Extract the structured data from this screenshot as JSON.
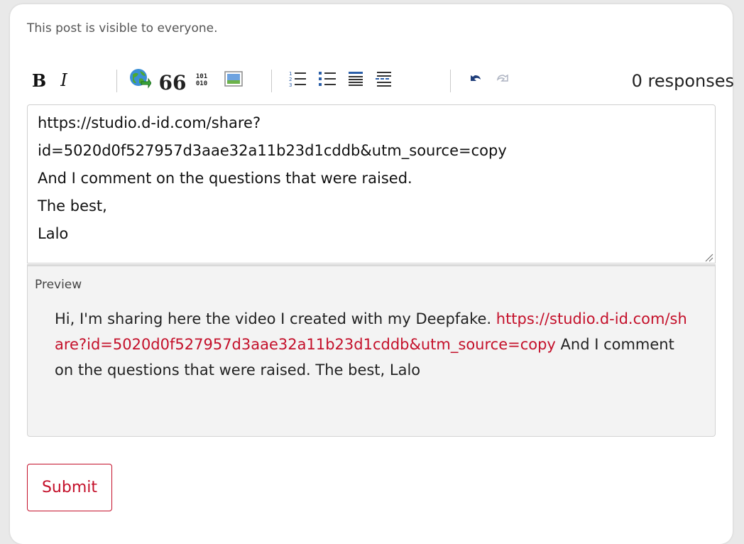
{
  "notice": "This post is visible to everyone.",
  "toolbar": {
    "bold_label": "B",
    "italic_label": "I",
    "quote_label": "66",
    "code_top": "101",
    "code_bottom": "010",
    "responses": "0 responses",
    "icons": [
      "bold-icon",
      "italic-icon",
      "link-icon",
      "blockquote-icon",
      "code-sample-icon",
      "image-icon",
      "numbered-list-icon",
      "bulleted-list-icon",
      "heading-icon",
      "horizontal-rule-icon",
      "undo-icon",
      "redo-icon"
    ]
  },
  "editor": {
    "value": "https://studio.d-id.com/share?\nid=5020d0f527957d3aae32a11b23d1cddb&utm_source=copy\nAnd I comment on the questions that were raised.\nThe best,\nLalo"
  },
  "preview": {
    "label": "Preview",
    "text_before": "Hi, I'm sharing here the video I created with my Deepfake. ",
    "link_text": "https://studio.d-id.com/share?id=5020d0f527957d3aae32a11b23d1cddb&utm_source=copy",
    "text_after": " And I comment on the questions that were raised. The best, Lalo"
  },
  "submit_label": "Submit",
  "colors": {
    "accent": "#c4102a",
    "preview_bg": "#f3f3f3",
    "text": "#222222"
  }
}
